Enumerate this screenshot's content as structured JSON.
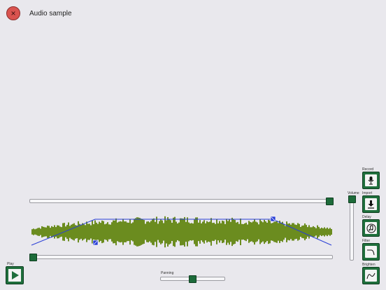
{
  "header": {
    "title": "Audio sample",
    "close_icon": "×"
  },
  "controls": {
    "volume_label": "Volume",
    "panning_label": "Panning",
    "play_label": "Play"
  },
  "tools": [
    {
      "label": "Record",
      "icon": "microphone-icon"
    },
    {
      "label": "Import",
      "icon": "import-download-icon"
    },
    {
      "label": "Delay",
      "icon": "delay-music-note-icon"
    },
    {
      "label": "Filter",
      "icon": "filter-curve-icon"
    },
    {
      "label": "Brighten",
      "icon": "brighten-curve-icon"
    }
  ],
  "colors": {
    "waveform": "#6b8c1f",
    "envelope": "#2a3fd6",
    "accent": "#1f6f3c",
    "close": "#d9534f"
  },
  "levels": {
    "top_slider": 1.0,
    "position_slider": 0.0,
    "volume": 1.0,
    "panning": 0.5
  }
}
